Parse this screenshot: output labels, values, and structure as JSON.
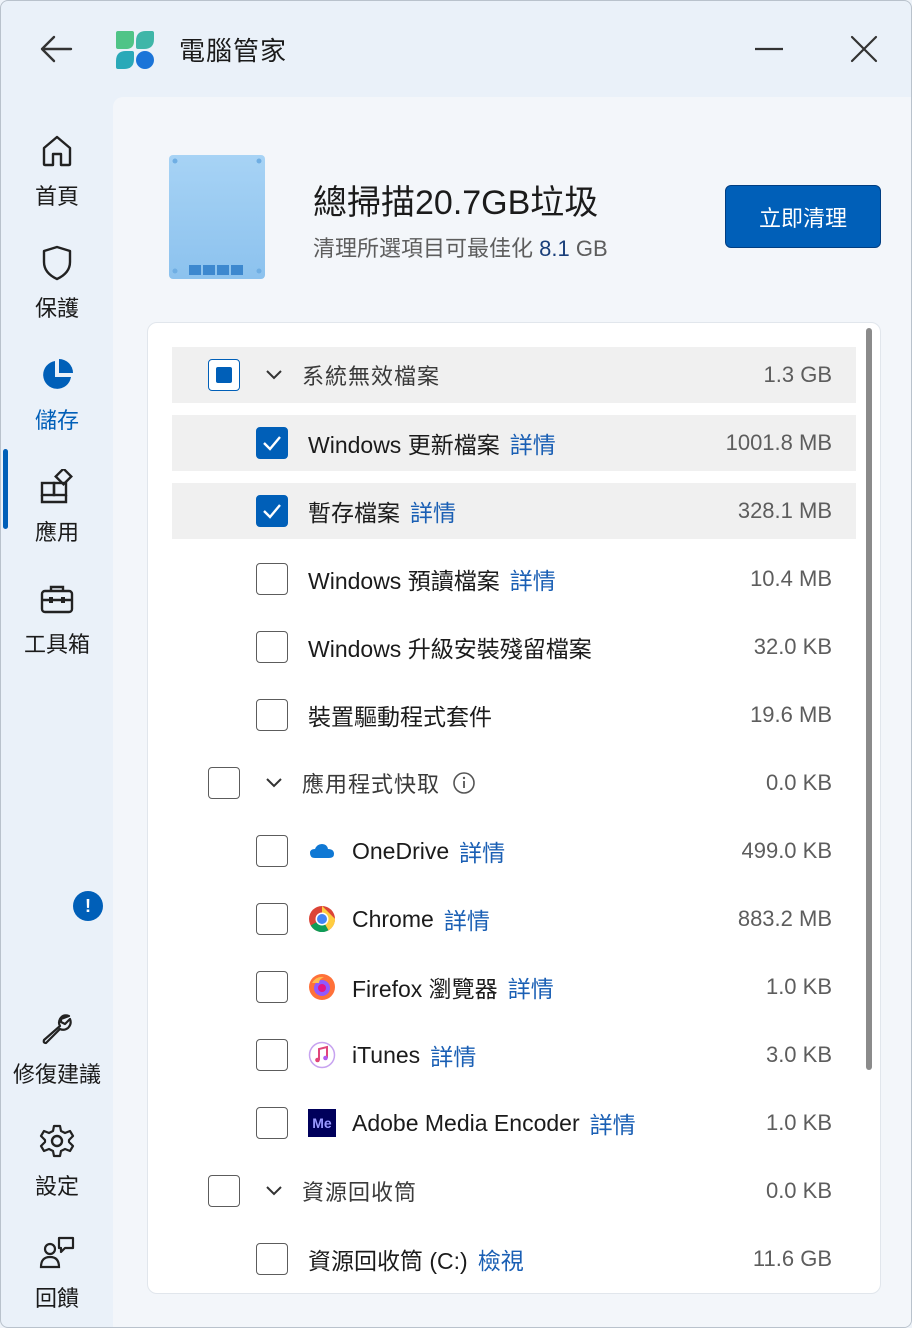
{
  "app": {
    "title": "電腦管家"
  },
  "sidebar": {
    "items": [
      {
        "label": "首頁",
        "icon": "home-icon"
      },
      {
        "label": "保護",
        "icon": "shield-icon"
      },
      {
        "label": "儲存",
        "icon": "pie-chart-icon",
        "active": true
      },
      {
        "label": "應用",
        "icon": "apps-icon"
      },
      {
        "label": "工具箱",
        "icon": "toolbox-icon"
      }
    ],
    "bottom_items": [
      {
        "label": "修復建議",
        "icon": "wrench-icon",
        "badge": "!"
      },
      {
        "label": "設定",
        "icon": "gear-icon"
      },
      {
        "label": "回饋",
        "icon": "feedback-icon"
      }
    ]
  },
  "summary": {
    "headline": "總掃描20.7GB垃圾",
    "subline_prefix": "清理所選項目可最佳化",
    "subline_value": "8.1",
    "subline_unit": "GB",
    "clean_button": "立即清理"
  },
  "list": {
    "groups": [
      {
        "name": "系統無效檔案",
        "size": "1.3 GB",
        "state": "partial",
        "items": [
          {
            "name": "Windows 更新檔案",
            "link": "詳情",
            "size": "1001.8 MB",
            "checked": true
          },
          {
            "name": "暫存檔案",
            "link": "詳情",
            "size": "328.1 MB",
            "checked": true
          },
          {
            "name": "Windows 預讀檔案",
            "link": "詳情",
            "size": "10.4 MB",
            "checked": false
          },
          {
            "name": "Windows 升級安裝殘留檔案",
            "link": "",
            "size": "32.0 KB",
            "checked": false
          },
          {
            "name": "裝置驅動程式套件",
            "link": "",
            "size": "19.6 MB",
            "checked": false
          }
        ]
      },
      {
        "name": "應用程式快取",
        "size": "0.0 KB",
        "state": "unchecked",
        "info": true,
        "items": [
          {
            "name": "OneDrive",
            "link": "詳情",
            "size": "499.0 KB",
            "icon": "onedrive-icon",
            "checked": false
          },
          {
            "name": "Chrome",
            "link": "詳情",
            "size": "883.2 MB",
            "icon": "chrome-icon",
            "checked": false
          },
          {
            "name": "Firefox 瀏覽器",
            "link": "詳情",
            "size": "1.0 KB",
            "icon": "firefox-icon",
            "checked": false
          },
          {
            "name": "iTunes",
            "link": "詳情",
            "size": "3.0 KB",
            "icon": "itunes-icon",
            "checked": false
          },
          {
            "name": "Adobe Media Encoder",
            "link": "詳情",
            "size": "1.0 KB",
            "icon": "adobe-media-encoder-icon",
            "icon_text": "Me",
            "checked": false
          }
        ]
      },
      {
        "name": "資源回收筒",
        "size": "0.0 KB",
        "state": "unchecked",
        "items": [
          {
            "name": "資源回收筒 (C:)",
            "link": "檢視",
            "size": "11.6 GB",
            "checked": false
          }
        ]
      }
    ]
  },
  "colors": {
    "accent": "#005fb8",
    "link": "#1a5fb4",
    "window_bg": "#eaf1f9"
  }
}
